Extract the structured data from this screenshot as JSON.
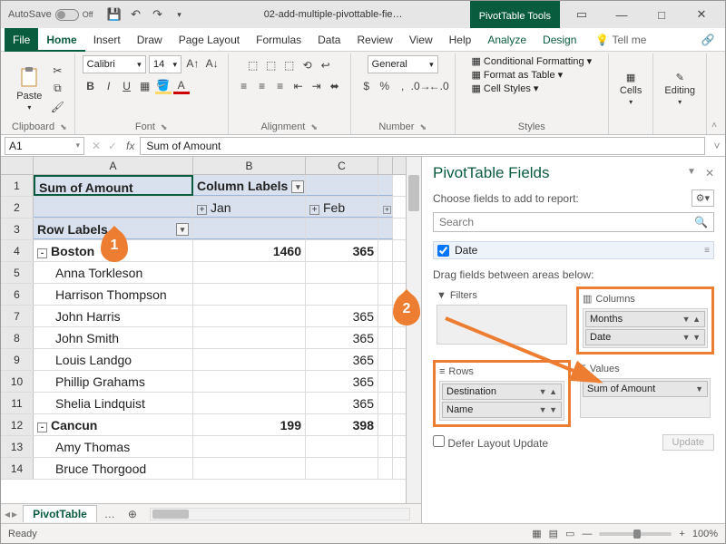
{
  "titlebar": {
    "autosave_label": "AutoSave",
    "off_label": "Off",
    "filename": "02-add-multiple-pivottable-fie…",
    "context_tool": "PivotTable Tools"
  },
  "tabs": {
    "file": "File",
    "home": "Home",
    "insert": "Insert",
    "draw": "Draw",
    "page_layout": "Page Layout",
    "formulas": "Formulas",
    "data": "Data",
    "review": "Review",
    "view": "View",
    "help": "Help",
    "analyze": "Analyze",
    "design": "Design",
    "tellme": "Tell me"
  },
  "ribbon": {
    "clipboard": {
      "label": "Clipboard",
      "paste": "Paste"
    },
    "font": {
      "label": "Font",
      "name": "Calibri",
      "size": "14"
    },
    "alignment": {
      "label": "Alignment"
    },
    "number": {
      "label": "Number",
      "format": "General"
    },
    "styles": {
      "label": "Styles",
      "cond": "Conditional Formatting",
      "table": "Format as Table",
      "cell": "Cell Styles"
    },
    "cells": {
      "label": "Cells"
    },
    "editing": {
      "label": "Editing"
    }
  },
  "namebox": "A1",
  "formula": "Sum of Amount",
  "columns": [
    "A",
    "B",
    "C"
  ],
  "pivot": {
    "r1A": "Sum of Amount",
    "r1B": "Column Labels",
    "r2B": "Jan",
    "r2C": "Feb",
    "r3A": "Row Labels",
    "rows": [
      {
        "n": "4",
        "a": "Boston",
        "b": "1460",
        "c": "365",
        "bold": true,
        "expand": "-"
      },
      {
        "n": "5",
        "a": "Anna Torkleson",
        "b": "",
        "c": ""
      },
      {
        "n": "6",
        "a": "Harrison Thompson",
        "b": "",
        "c": ""
      },
      {
        "n": "7",
        "a": "John Harris",
        "b": "",
        "c": "365"
      },
      {
        "n": "8",
        "a": "John Smith",
        "b": "",
        "c": "365"
      },
      {
        "n": "9",
        "a": "Louis Landgo",
        "b": "",
        "c": "365"
      },
      {
        "n": "10",
        "a": "Phillip Grahams",
        "b": "",
        "c": "365"
      },
      {
        "n": "11",
        "a": "Shelia Lindquist",
        "b": "",
        "c": "365"
      },
      {
        "n": "12",
        "a": "Cancun",
        "b": "199",
        "c": "398",
        "bold": true,
        "expand": "-"
      },
      {
        "n": "13",
        "a": "Amy Thomas",
        "b": "",
        "c": ""
      },
      {
        "n": "14",
        "a": "Bruce Thorgood",
        "b": "",
        "c": ""
      }
    ]
  },
  "sheet_tab": "PivotTable",
  "pane": {
    "title": "PivotTable Fields",
    "choose": "Choose fields to add to report:",
    "search_ph": "Search",
    "field_date": "Date",
    "drag_hint": "Drag fields between areas below:",
    "filters": "Filters",
    "columns": "Columns",
    "rows": "Rows",
    "values": "Values",
    "col_items": [
      "Months",
      "Date"
    ],
    "row_items": [
      "Destination",
      "Name"
    ],
    "val_items": [
      "Sum of Amount"
    ],
    "defer": "Defer Layout Update",
    "update": "Update"
  },
  "status": {
    "ready": "Ready",
    "zoom": "100%"
  },
  "badges": {
    "one": "1",
    "two": "2"
  }
}
